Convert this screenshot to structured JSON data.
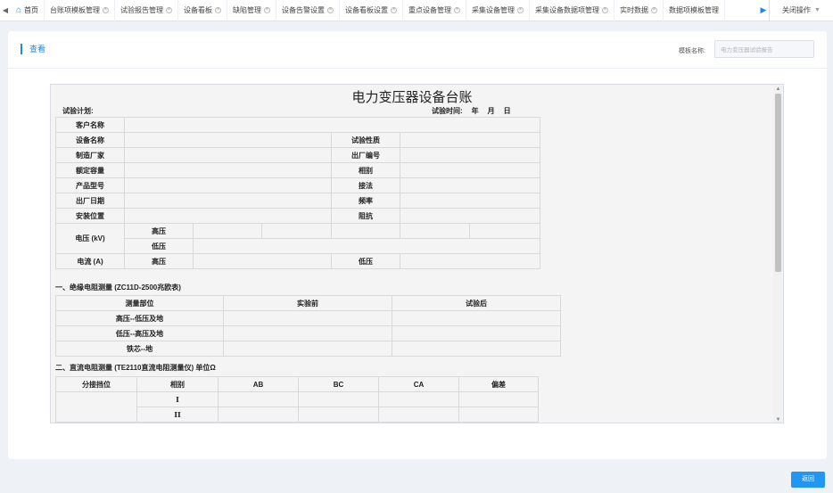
{
  "tabbar": {
    "tabs": [
      {
        "label": "首页",
        "home": true
      },
      {
        "label": "台账项模板管理"
      },
      {
        "label": "试验报告管理"
      },
      {
        "label": "设备看板"
      },
      {
        "label": "缺陷管理"
      },
      {
        "label": "设备告警设置"
      },
      {
        "label": "设备看板设置"
      },
      {
        "label": "重点设备管理"
      },
      {
        "label": "采集设备管理"
      },
      {
        "label": "采集设备数据项管理"
      },
      {
        "label": "实时数据"
      },
      {
        "label": "数据项模板管理"
      }
    ],
    "close_ops_label": "关闭操作"
  },
  "header": {
    "view_title": "查看",
    "template_name_label": "模板名称:",
    "template_name_value": "电力变压器试验报告"
  },
  "document": {
    "title": "电力变压器设备台账",
    "plan_label": "试验计划:",
    "time_label": "试验时间:",
    "time_year": "年",
    "time_month": "月",
    "time_day": "日",
    "info": {
      "customer_name": "客户名称",
      "device_name": "设备名称",
      "test_nature": "试验性质",
      "manufacturer": "制造厂家",
      "factory_no": "出厂编号",
      "rated_capacity": "额定容量",
      "phase": "相别",
      "product_model": "产品型号",
      "connection": "接法",
      "factory_date": "出厂日期",
      "frequency": "频率",
      "install_location": "安装位置",
      "impedance": "阻抗",
      "voltage_kv": "电压 (kV)",
      "high_voltage": "高压",
      "low_voltage": "低压",
      "current_a": "电流 (A)",
      "current_high": "高压",
      "current_low": "低压"
    },
    "insulation": {
      "section_title": "一、绝缘电阻测量 (ZC11D-2500兆欧表)",
      "headers": [
        "测量部位",
        "实验前",
        "试验后"
      ],
      "rows": [
        "高压--低压及地",
        "低压--高压及地",
        "铁芯--地"
      ]
    },
    "dc_resistance": {
      "section_title": "二、直流电阻测量 (TE2110直流电阻测量仪) 单位Ω",
      "headers": [
        "分接挡位",
        "相别",
        "AB",
        "BC",
        "CA",
        "偏差"
      ],
      "rows": [
        "I",
        "II"
      ]
    }
  },
  "footer": {
    "return_label": "返回"
  }
}
